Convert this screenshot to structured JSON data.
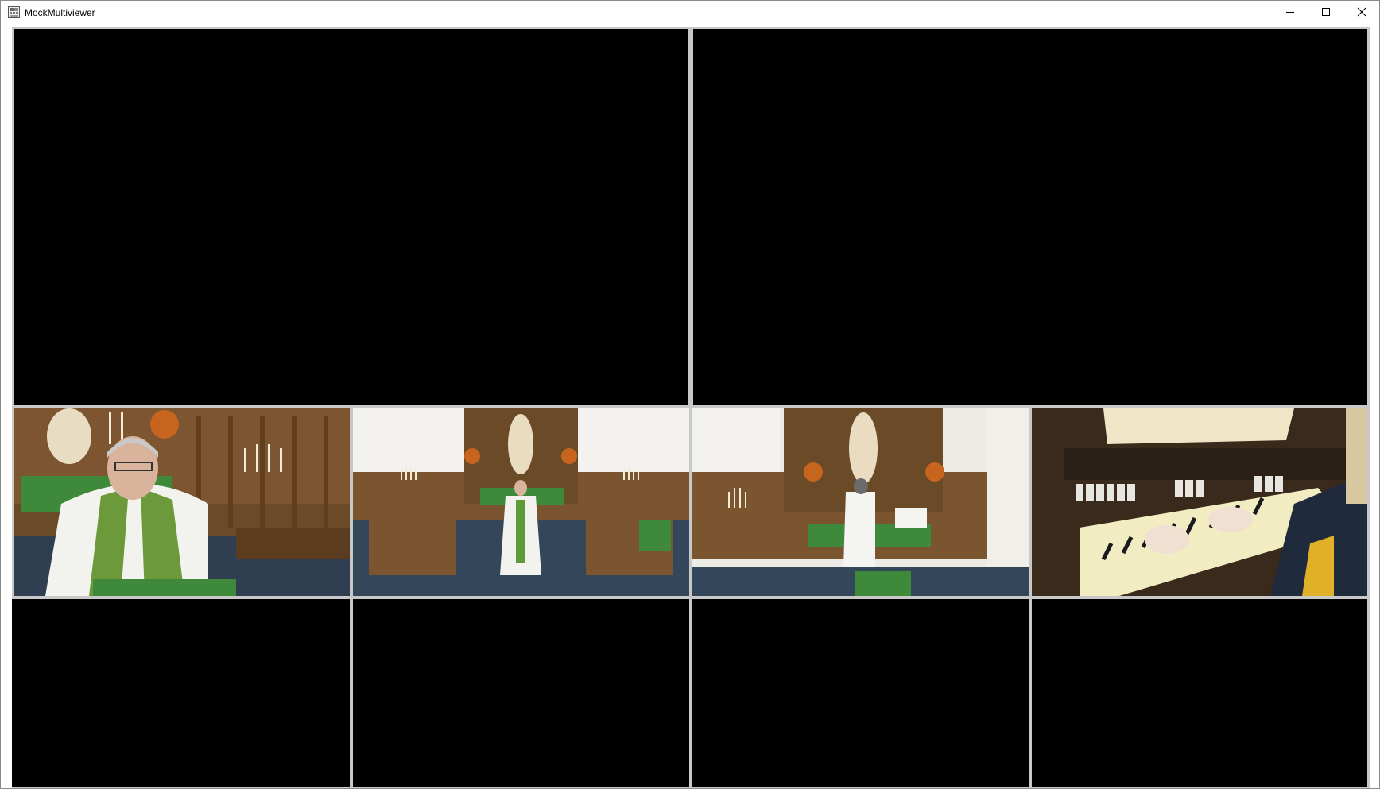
{
  "window": {
    "title": "MockMultiviewer",
    "controls": [
      "minimize-icon",
      "maximize-icon",
      "close-icon"
    ]
  },
  "viewer": {
    "large_tiles": [
      {
        "name": "preview-tile-1",
        "content": "no-signal"
      },
      {
        "name": "preview-tile-2",
        "content": "no-signal"
      }
    ],
    "camera_tiles": [
      {
        "name": "camera-tile-1",
        "content": "camera-feed"
      },
      {
        "name": "camera-tile-2",
        "content": "camera-feed"
      },
      {
        "name": "camera-tile-3",
        "content": "camera-feed"
      },
      {
        "name": "camera-tile-4",
        "content": "camera-feed"
      }
    ],
    "empty_tiles": [
      {
        "name": "input-tile-5",
        "content": "no-signal"
      },
      {
        "name": "input-tile-6",
        "content": "no-signal"
      },
      {
        "name": "input-tile-7",
        "content": "no-signal"
      },
      {
        "name": "input-tile-8",
        "content": "no-signal"
      }
    ]
  },
  "colors": {
    "title_bar": "#ffffff",
    "grid_border": "#c8c8c8",
    "empty_tile": "#000000",
    "vestment_green": "#3f8a3a",
    "wood": "#7a5530",
    "carpet": "#33465a"
  }
}
